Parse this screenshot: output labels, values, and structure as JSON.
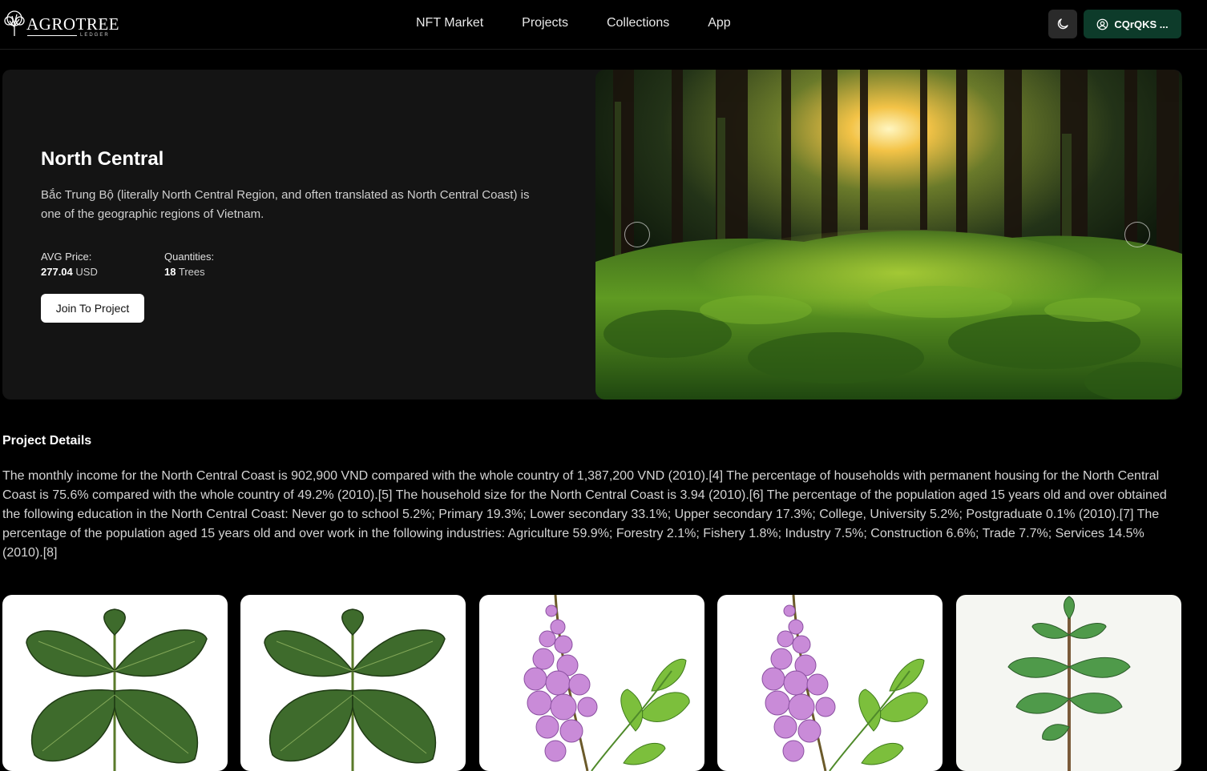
{
  "header": {
    "logo_text": "AGROTREE",
    "logo_sub": "LEDGER",
    "nav": [
      "NFT Market",
      "Projects",
      "Collections",
      "App"
    ],
    "wallet_label": "CQrQKS ...",
    "icons": {
      "theme": "moon-icon",
      "wallet": "user-circle-icon"
    }
  },
  "hero": {
    "title": "North Central",
    "description": "Bắc Trung Bộ (literally North Central Region, and often translated as North Central Coast) is one of the geographic regions of Vietnam.",
    "avg_price_label": "AVG Price:",
    "avg_price_value": "277.04",
    "avg_price_unit": "USD",
    "quantities_label": "Quantities:",
    "quantities_value": "18",
    "quantities_unit": "Trees",
    "join_label": "Join To Project"
  },
  "details": {
    "title": "Project Details",
    "text": "The monthly income for the North Central Coast is 902,900 VND compared with the whole country of 1,387,200 VND (2010).[4] The percentage of households with permanent housing for the North Central Coast is 75.6% compared with the whole country of 49.2% (2010).[5] The household size for the North Central Coast is 3.94 (2010).[6] The percentage of the population aged 15 years old and over obtained the following education in the North Central Coast: Never go to school 5.2%; Primary 19.3%; Lower secondary 33.1%; Upper secondary 17.3%; College, University 5.2%; Postgraduate 0.1% (2010).[7] The percentage of the population aged 15 years old and over work in the following industries: Agriculture 59.9%; Forestry 2.1%; Fishery 1.8%; Industry 7.5%; Construction 6.6%; Trade 7.7%; Services 14.5% (2010).[8]"
  },
  "colors": {
    "accent": "#0d3b2a",
    "background": "#000000",
    "panel": "#141414"
  }
}
